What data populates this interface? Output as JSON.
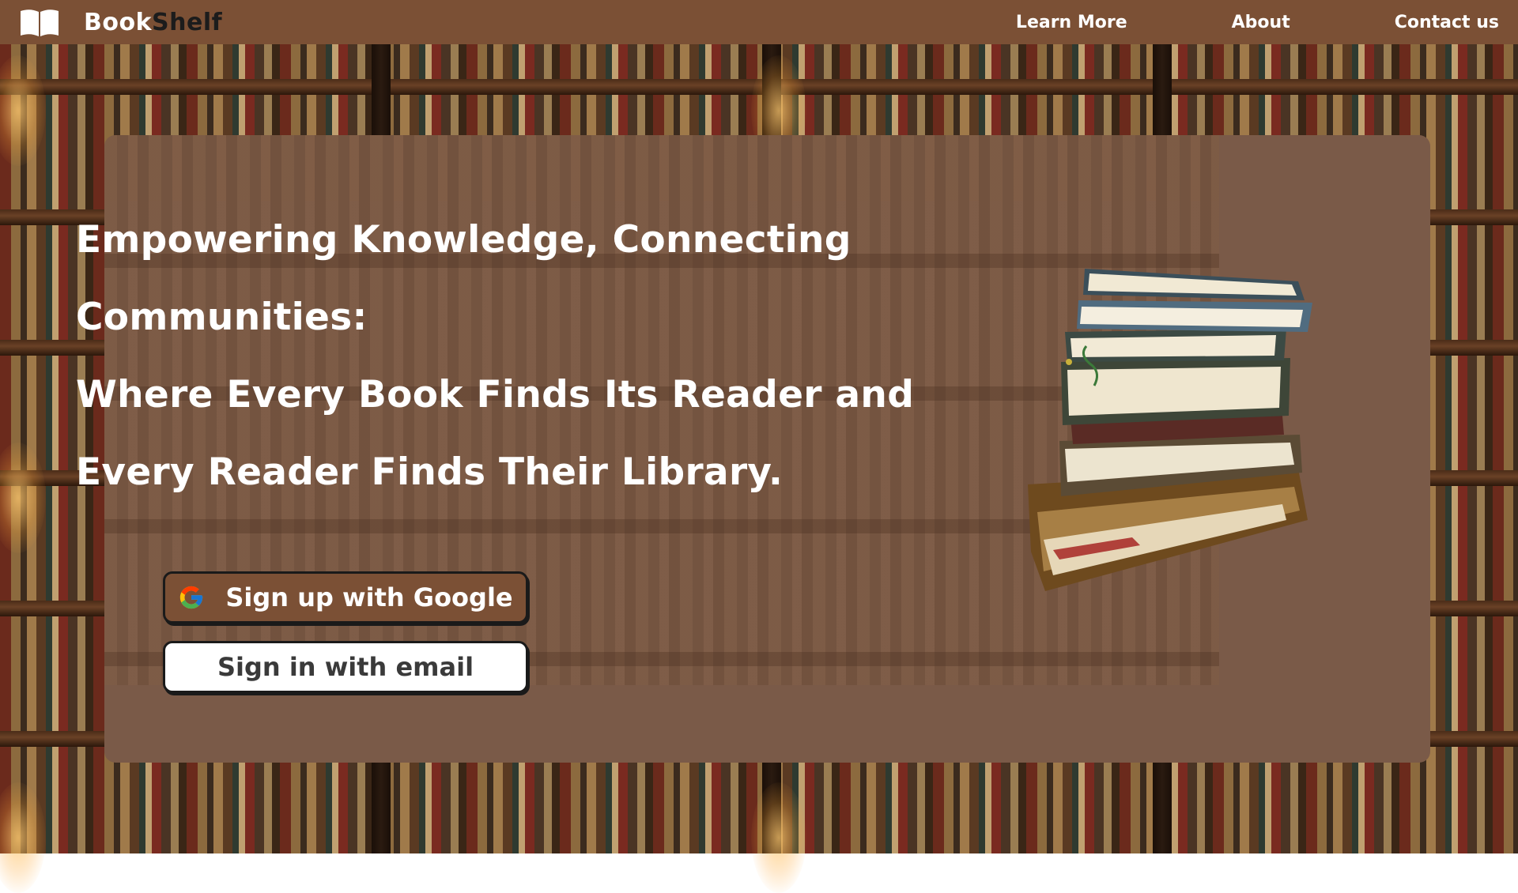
{
  "brand": {
    "name_part1": "Book",
    "name_part2": "Shelf",
    "logo_icon": "open-book-icon"
  },
  "nav": {
    "items": [
      {
        "label": "Learn More"
      },
      {
        "label": "About"
      },
      {
        "label": "Contact us"
      }
    ]
  },
  "hero": {
    "headline_lines": [
      "Empowering Knowledge, Connecting",
      "Communities:",
      "Where Every Book Finds Its Reader and",
      "Every Reader Finds Their Library."
    ],
    "illustration": "book-stack-illustration"
  },
  "auth": {
    "google_label": "Sign up with Google",
    "google_icon": "google-logo-icon",
    "email_label": "Sign in with email"
  },
  "colors": {
    "nav_bg": "#7b5035",
    "card_bg": "#7a5a48",
    "google_button_bg": "#7b5035",
    "email_button_bg": "#ffffff",
    "brand_accent": "#1c1c1c"
  }
}
